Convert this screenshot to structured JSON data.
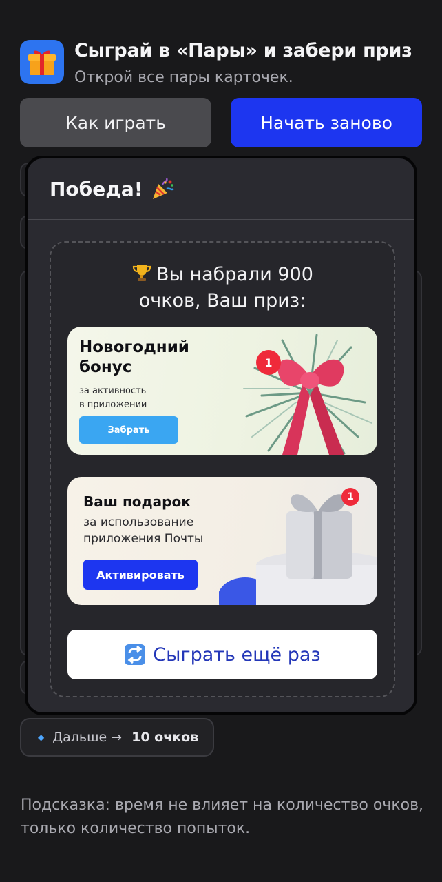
{
  "header": {
    "app_icon": "gift-icon",
    "title": "Сыграй в «Пары» и забери приз",
    "subtitle": "Открой все пары карточек."
  },
  "buttons": {
    "how_to_play": "Как играть",
    "restart": "Начать заново"
  },
  "modal": {
    "title": "Победа!",
    "title_icon": "party-popper-icon",
    "score_icon": "trophy-icon",
    "score_line1": "Вы набрали 900",
    "score_line2": "очков, Ваш приз:",
    "prize_banners": [
      {
        "title_line1": "Новогодний",
        "title_line2": "бонус",
        "sub_line1": "за активность",
        "sub_line2": "в приложении",
        "button": "Забрать",
        "badge": "1",
        "image": "christmas-wreath-bow"
      },
      {
        "title_line1": "Ваш подарок",
        "sub_line1": "за использование",
        "sub_line2": "приложения Почты",
        "button": "Активировать",
        "badge": "1",
        "image": "silver-gift-box"
      }
    ],
    "replay_icon": "repeat-icon",
    "replay_label": "Сыграть ещё раз"
  },
  "next": {
    "icon": "diamond-icon",
    "label": "Дальше →",
    "points": "10 очков"
  },
  "hint": "Подсказка: время не влияет на количество очков, только количество попыток.",
  "colors": {
    "background": "#19191b",
    "primary_button": "#1d36f0",
    "secondary_button": "#4a4a4e",
    "modal": "#2a2a30",
    "take_button": "#3aa6f2",
    "activate_button": "#1d36f0",
    "badge": "#ef2a3a"
  }
}
